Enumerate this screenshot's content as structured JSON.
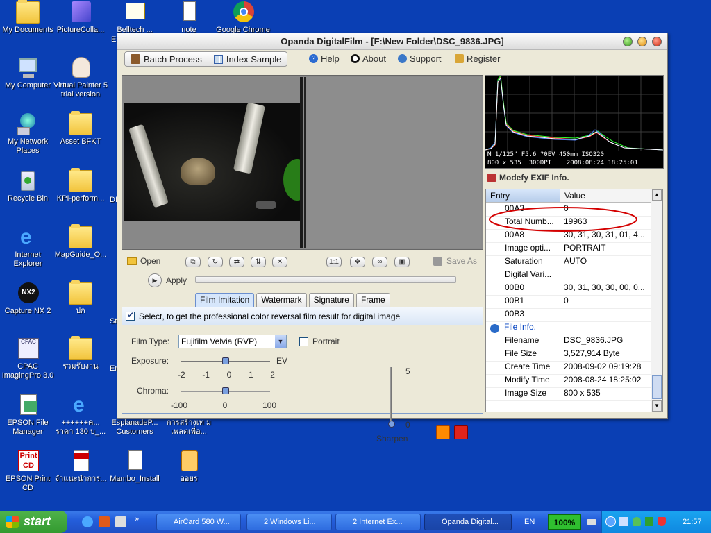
{
  "desktop": {
    "icons": [
      {
        "label": "My Documents"
      },
      {
        "label": "PictureColla..."
      },
      {
        "label": "Belltech ..."
      },
      {
        "label": "note"
      },
      {
        "label": "Google Chrome"
      },
      {
        "label": "My Computer"
      },
      {
        "label": "Virtual Painter 5 trial version"
      },
      {
        "label": "My Network Places"
      },
      {
        "label": "Asset BFKT"
      },
      {
        "label": "Recycle Bin"
      },
      {
        "label": "KPI-perform..."
      },
      {
        "label": "Internet Explorer"
      },
      {
        "label": "MapGuide_O..."
      },
      {
        "label": "Capture NX 2"
      },
      {
        "label": "ปก"
      },
      {
        "label": "CPAC ImagingPro 3.0"
      },
      {
        "label": "รวมรับงาน"
      },
      {
        "label": "EPSON File Manager"
      },
      {
        "label": "++++++ค... ราคา 130 บ_..."
      },
      {
        "label": "EsplanadeP... Customers"
      },
      {
        "label": "การสร้างเท มเพลตเพื่อ..."
      },
      {
        "label": "EPSON Print CD"
      },
      {
        "label": "จำแนะนำการ..."
      },
      {
        "label": "Mambo_Install"
      },
      {
        "label": "ออยร"
      }
    ],
    "partial_labels": [
      "E",
      "DI",
      "St",
      "En"
    ]
  },
  "window": {
    "title": "Opanda DigitalFilm - [F:\\New Folder\\DSC_9836.JPG]",
    "toolbar": {
      "batch_process": "Batch Process",
      "index_sample": "Index Sample",
      "help": "Help",
      "about": "About",
      "support": "Support",
      "register": "Register"
    },
    "histogram": {
      "info_line1": "M 1/125\" F5.6 ?0EV 450mm ISO320",
      "info_line2": "800 x 535  300DPI    2008:08:24 18:25:01"
    },
    "exif": {
      "title": "Modefy EXIF Info.",
      "col_entry": "Entry",
      "col_value": "Value",
      "rows": [
        {
          "k": "00A3",
          "v": "0"
        },
        {
          "k": "Total Numb...",
          "v": "19963"
        },
        {
          "k": "00A8",
          "v": "30, 31, 30, 31, 01, 4..."
        },
        {
          "k": "Image opti...",
          "v": "PORTRAIT"
        },
        {
          "k": "Saturation",
          "v": "AUTO"
        },
        {
          "k": "Digital Vari...",
          "v": ""
        },
        {
          "k": "00B0",
          "v": "30, 31, 30, 30, 00, 0..."
        },
        {
          "k": "00B1",
          "v": "0"
        },
        {
          "k": "00B3",
          "v": ""
        },
        {
          "k": "File Info.",
          "v": ""
        },
        {
          "k": "Filename",
          "v": "DSC_9836.JPG"
        },
        {
          "k": "File Size",
          "v": "3,527,914 Byte"
        },
        {
          "k": "Create Time",
          "v": "2008-09-02 09:19:28"
        },
        {
          "k": "Modify Time",
          "v": "2008-08-24 18:25:02"
        },
        {
          "k": "Image Size",
          "v": "800 x 535"
        },
        {
          "k": "",
          "v": ""
        }
      ]
    },
    "controls": {
      "open": "Open",
      "save_as": "Save As",
      "apply": "Apply",
      "zoom_1_1": "1:1"
    },
    "tabs": [
      "Film Imitation",
      "Watermark",
      "Signature",
      "Frame"
    ],
    "panel": {
      "checkbox_label": "Select, to get the professional color reversal film result for digital image",
      "film_type_label": "Film Type:",
      "film_type_value": "Fujifilm Velvia (RVP)",
      "portrait_label": "Portrait",
      "exposure_label": "Exposure:",
      "exposure_unit": "EV",
      "exposure_ticks": [
        "-2",
        "-1",
        "0",
        "1",
        "2"
      ],
      "exposure_value": 0,
      "chroma_label": "Chroma:",
      "chroma_ticks": [
        "-100",
        "0",
        "100"
      ],
      "chroma_value": 0,
      "sharpen_label": "Sharpen",
      "sharpen_max": "5",
      "sharpen_min": "0",
      "sharpen_value": 0
    }
  },
  "taskbar": {
    "start": "start",
    "items": [
      "AirCard 580 W...",
      "2 Windows Li...",
      "2 Internet Ex...",
      "Opanda Digital..."
    ],
    "lang": "EN",
    "battery": "100%",
    "clock": "21:57"
  },
  "colors": {
    "desktop": "#0a3fb4",
    "annotation_circle": "#d40000",
    "active_tab": "#d6e6fb"
  }
}
